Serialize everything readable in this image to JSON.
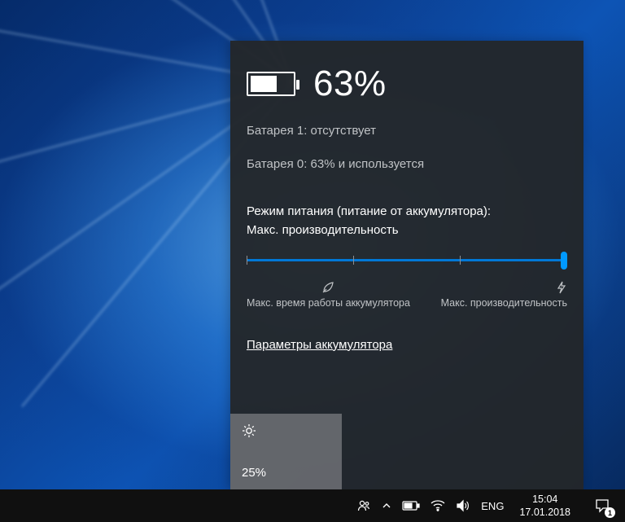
{
  "battery": {
    "percent": "63%",
    "battery1_status": "Батарея 1: отсутствует",
    "battery0_status": "Батарея 0: 63% и используется"
  },
  "power_mode": {
    "label_line1": "Режим питания (питание от аккумулятора):",
    "label_line2": "Макс. производительность",
    "left_label": "Макс. время работы аккумулятора",
    "right_label": "Макс. производительность"
  },
  "settings_link": "Параметры аккумулятора",
  "brightness": {
    "value": "25%"
  },
  "taskbar": {
    "language": "ENG",
    "time": "15:04",
    "date": "17.01.2018",
    "notification_count": "1"
  }
}
